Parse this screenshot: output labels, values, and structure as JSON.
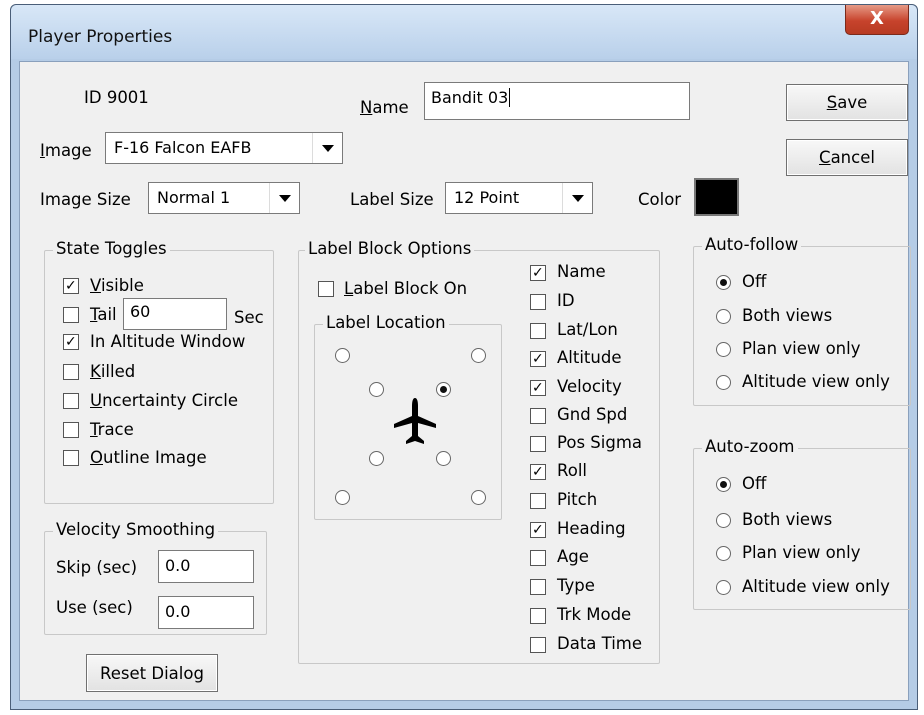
{
  "window": {
    "title": "Player Properties",
    "close_glyph": "X"
  },
  "header": {
    "id_label": "ID 9001",
    "name_label": "Name",
    "name_value": "Bandit 03",
    "image_label": "Image",
    "image_value": "F-16 Falcon EAFB",
    "image_size_label": "Image Size",
    "image_size_value": "Normal  1",
    "label_size_label": "Label Size",
    "label_size_value": "12 Point",
    "color_label": "Color",
    "color_value": "#000000"
  },
  "buttons": {
    "save": "Save",
    "cancel": "Cancel",
    "reset": "Reset Dialog"
  },
  "state_toggles": {
    "title": "State Toggles",
    "items": [
      {
        "label": "Visible",
        "checked": true
      },
      {
        "label": "Tail",
        "checked": false
      },
      {
        "label": "In Altitude Window",
        "checked": true
      },
      {
        "label": "Killed",
        "checked": false
      },
      {
        "label": "Uncertainty Circle",
        "checked": false
      },
      {
        "label": "Trace",
        "checked": false
      },
      {
        "label": "Outline Image",
        "checked": false
      }
    ],
    "tail_value": "60",
    "tail_unit": "Sec"
  },
  "velocity_smoothing": {
    "title": "Velocity Smoothing",
    "skip_label": "Skip (sec)",
    "skip_value": "0.0",
    "use_label": "Use  (sec)",
    "use_value": "0.0"
  },
  "label_block": {
    "title": "Label Block Options",
    "on_label": "Label Block On",
    "on_checked": false,
    "location_title": "Label Location",
    "selected_location": "right-near",
    "icon": "airplane-icon",
    "fields": [
      {
        "label": "Name",
        "checked": true
      },
      {
        "label": "ID",
        "checked": false
      },
      {
        "label": "Lat/Lon",
        "checked": false
      },
      {
        "label": "Altitude",
        "checked": true
      },
      {
        "label": "Velocity",
        "checked": true
      },
      {
        "label": "Gnd Spd",
        "checked": false
      },
      {
        "label": "Pos Sigma",
        "checked": false
      },
      {
        "label": "Roll",
        "checked": true
      },
      {
        "label": "Pitch",
        "checked": false
      },
      {
        "label": "Heading",
        "checked": true
      },
      {
        "label": "Age",
        "checked": false
      },
      {
        "label": "Type",
        "checked": false
      },
      {
        "label": "Trk Mode",
        "checked": false
      },
      {
        "label": "Data Time",
        "checked": false
      }
    ]
  },
  "auto_follow": {
    "title": "Auto-follow",
    "options": [
      "Off",
      "Both views",
      "Plan view only",
      "Altitude view only"
    ],
    "selected": 0
  },
  "auto_zoom": {
    "title": "Auto-zoom",
    "options": [
      "Off",
      "Both views",
      "Plan view only",
      "Altitude view only"
    ],
    "selected": 0
  }
}
